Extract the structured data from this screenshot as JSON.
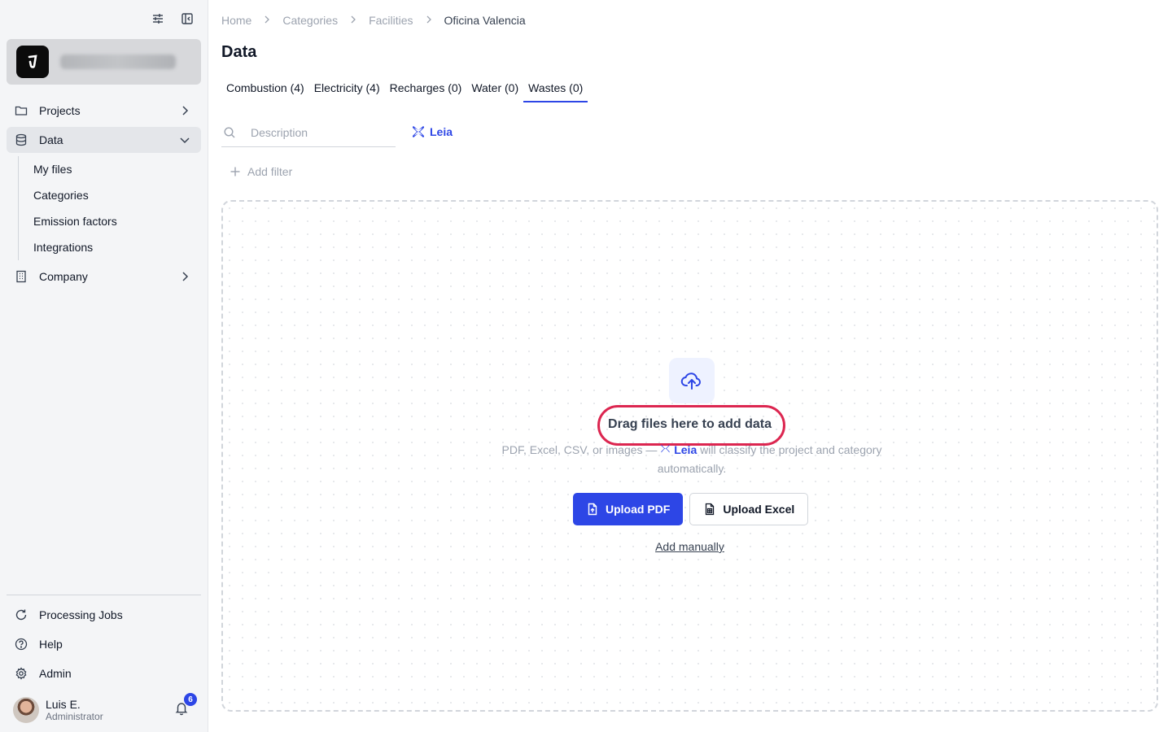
{
  "sidebar": {
    "nav": [
      {
        "label": "Projects",
        "icon": "folder-icon"
      },
      {
        "label": "Data",
        "icon": "database-icon"
      },
      {
        "label": "Company",
        "icon": "building-icon"
      }
    ],
    "data_subitems": [
      "My files",
      "Categories",
      "Emission factors",
      "Integrations"
    ],
    "bottom": [
      {
        "label": "Processing Jobs",
        "icon": "refresh-icon"
      },
      {
        "label": "Help",
        "icon": "help-circle-icon"
      },
      {
        "label": "Admin",
        "icon": "gear-icon"
      }
    ],
    "user": {
      "name": "Luis E.",
      "role": "Administrator",
      "notifications": "6"
    }
  },
  "breadcrumb": [
    "Home",
    "Categories",
    "Facilities",
    "Oficina Valencia"
  ],
  "page_title": "Data",
  "tabs": [
    {
      "label": "Combustion (4)"
    },
    {
      "label": "Electricity (4)"
    },
    {
      "label": "Recharges (0)"
    },
    {
      "label": "Water (0)"
    },
    {
      "label": "Wastes (0)",
      "active": true
    }
  ],
  "search": {
    "placeholder": "Description"
  },
  "leia_label": "Leia",
  "add_filter": "Add filter",
  "dropzone": {
    "title": "Drag files here to add data",
    "sub_prefix": "PDF, Excel, CSV, or images —",
    "sub_leia": "Leia",
    "sub_suffix": "will classify the project and category automatically.",
    "upload_pdf": "Upload PDF",
    "upload_excel": "Upload Excel",
    "add_manually": "Add manually"
  },
  "colors": {
    "accent": "#2d46e6",
    "highlight": "#dc2650"
  }
}
